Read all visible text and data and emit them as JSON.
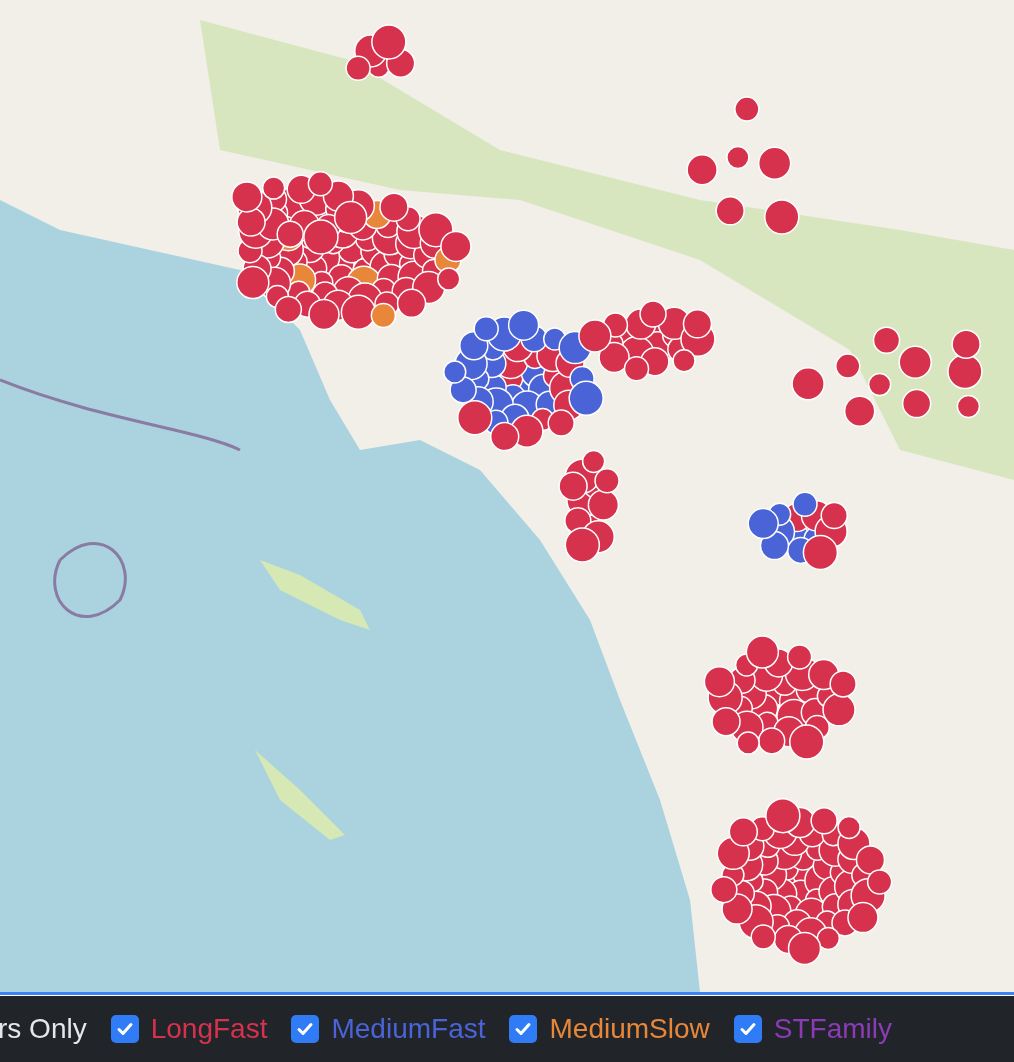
{
  "legend": {
    "cut_label": "rs Only",
    "filters": [
      {
        "label": "LongFast",
        "checked": true,
        "color": "#d6314d"
      },
      {
        "label": "MediumFast",
        "checked": true,
        "color": "#4a63d6"
      },
      {
        "label": "MediumSlow",
        "checked": true,
        "color": "#e8863a"
      },
      {
        "label": "STFamily",
        "checked": true,
        "color": "#8b3bb5"
      }
    ]
  }
}
